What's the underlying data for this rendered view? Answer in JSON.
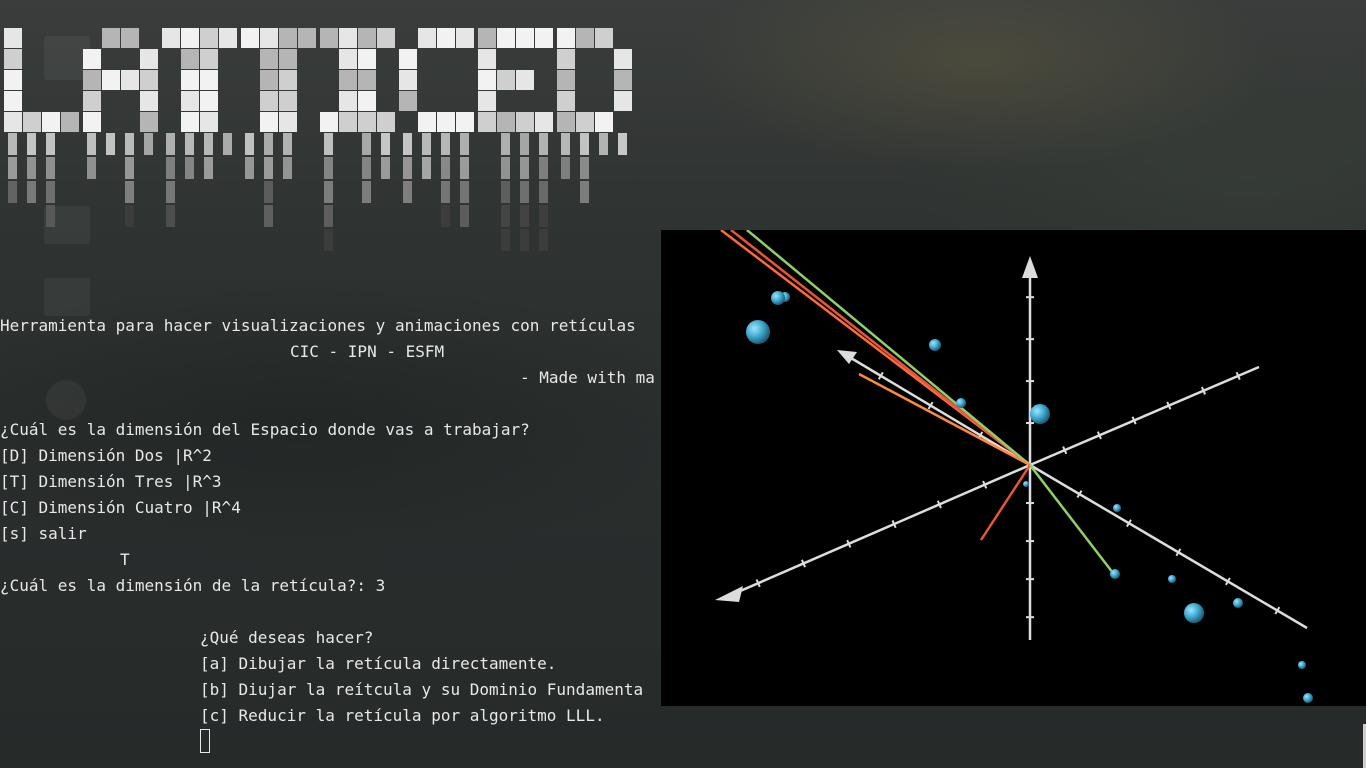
{
  "terminal": {
    "description_line": "Herramienta para hacer visualizaciones y animaciones con retículas",
    "credits_line": "CIC - IPN - ESFM",
    "made_with_line": "- Made with ma",
    "question_dimension": "¿Cuál es la dimensión del Espacio donde vas a trabajar?",
    "options": [
      "[D] Dimensión Dos |R^2",
      "[T] Dimensión Tres |R^3",
      "[C] Dimensión Cuatro |R^4",
      "[s] salir"
    ],
    "user_input_choice": "T",
    "question_lattice": "¿Cuál es la dimensión de la retícula?: 3",
    "question_action": "¿Qué deseas hacer?",
    "actions": [
      "[a] Dibujar la retícula directamente.",
      "[b] Diujar la reítcula y su Dominio Fundamenta",
      "[c] Reducir la retícula por algoritmo LLL."
    ]
  },
  "logo": {
    "text": "LATTICED"
  },
  "plot": {
    "vector_colors": [
      "#ff6a3d",
      "#e8553a",
      "#8fd06a",
      "#ff8a3d",
      "#6f7fbf"
    ],
    "point_color": "#3fa9d0",
    "axis_color": "#dddddd"
  }
}
